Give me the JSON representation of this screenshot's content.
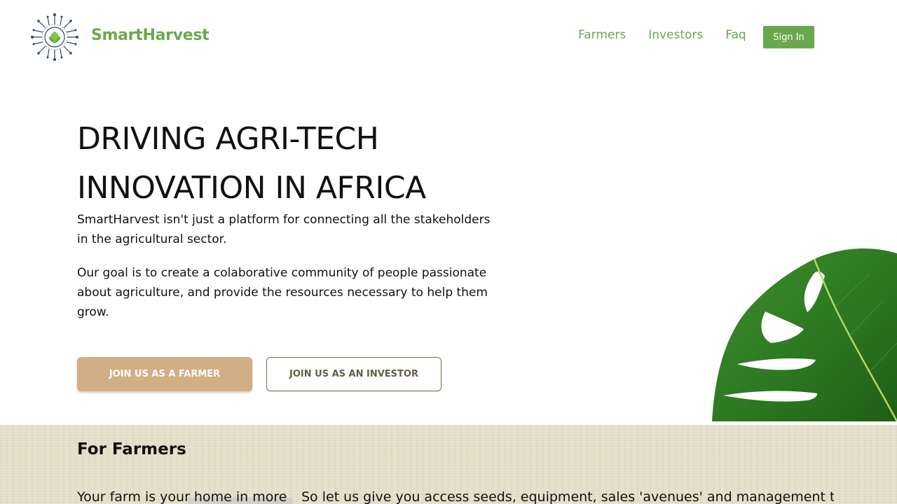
{
  "header": {
    "brand": "SmartHarvest",
    "nav": [
      "Farmers",
      "Investors",
      "Faq"
    ],
    "signin_label": "Sign In"
  },
  "hero": {
    "title_line1": "DRIVING AGRI-TECH",
    "title_line2": "INNOVATION IN AFRICA",
    "paragraph1": "SmartHarvest isn't just a platform for connecting all the stakeholders in the agricultural sector.",
    "paragraph2": "Our goal is to create a colaborative community of people passionate about agriculture, and provide the resources necessary to help them grow.",
    "farmer_button": "JOIN US AS A FARMER",
    "investor_button": "JOIN US AS AN INVESTOR"
  },
  "farmers": {
    "title": "For Farmers",
    "left_text": "Your farm is your home in more",
    "right_text": "So let us give you access seeds, equipment, sales 'avenues' and management tools"
  },
  "colors": {
    "brand_green": "#6aa84f",
    "tan": "#d2ae84",
    "brown": "#6b5a44"
  },
  "icons": [
    "smartharvest-logo-icon",
    "monstera-leaf-image"
  ]
}
